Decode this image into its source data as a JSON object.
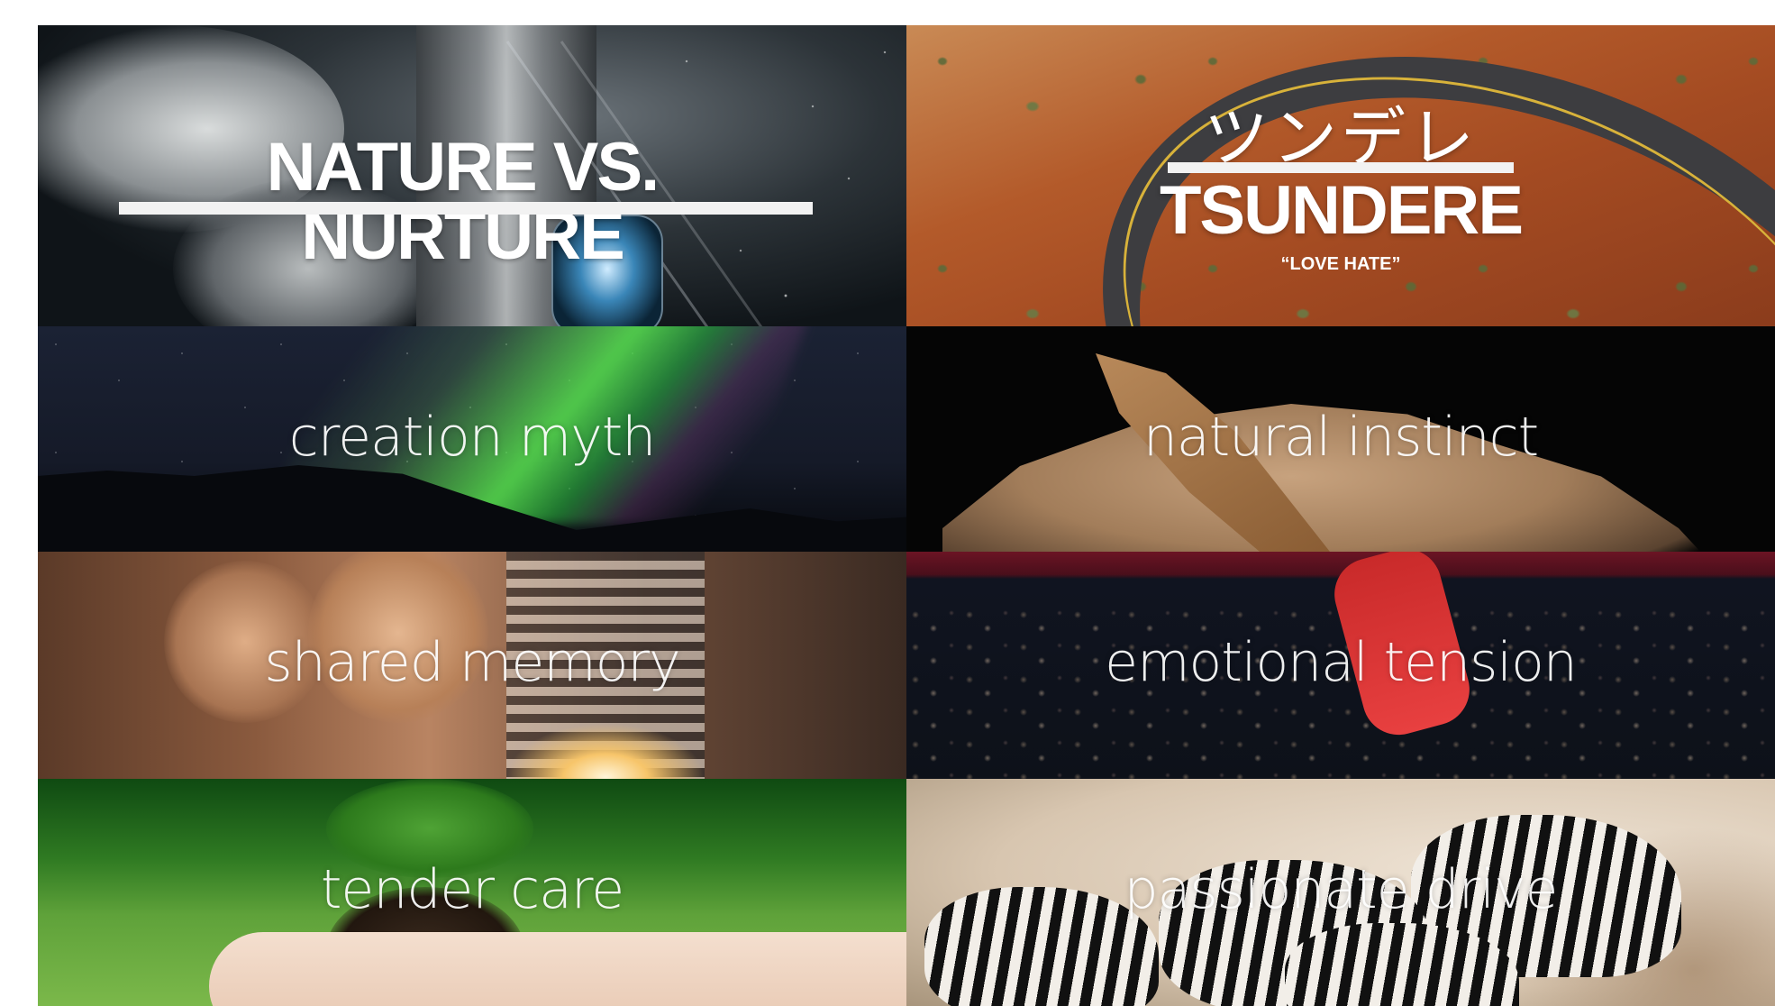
{
  "tiles": {
    "nature": {
      "title": "NATURE VS. NURTURE"
    },
    "tsundere": {
      "japanese": "ツンデレ",
      "title": "TSUNDERE",
      "subtitle": "“LOVE HATE”"
    },
    "creation": {
      "label": "creation myth"
    },
    "instinct": {
      "label": "natural instinct"
    },
    "memory": {
      "label": "shared memory"
    },
    "tension": {
      "label": "emotional tension"
    },
    "care": {
      "label": "tender care"
    },
    "drive": {
      "label": "passionate drive"
    }
  },
  "colors": {
    "background": "#ffffff",
    "text": "#ffffff"
  }
}
